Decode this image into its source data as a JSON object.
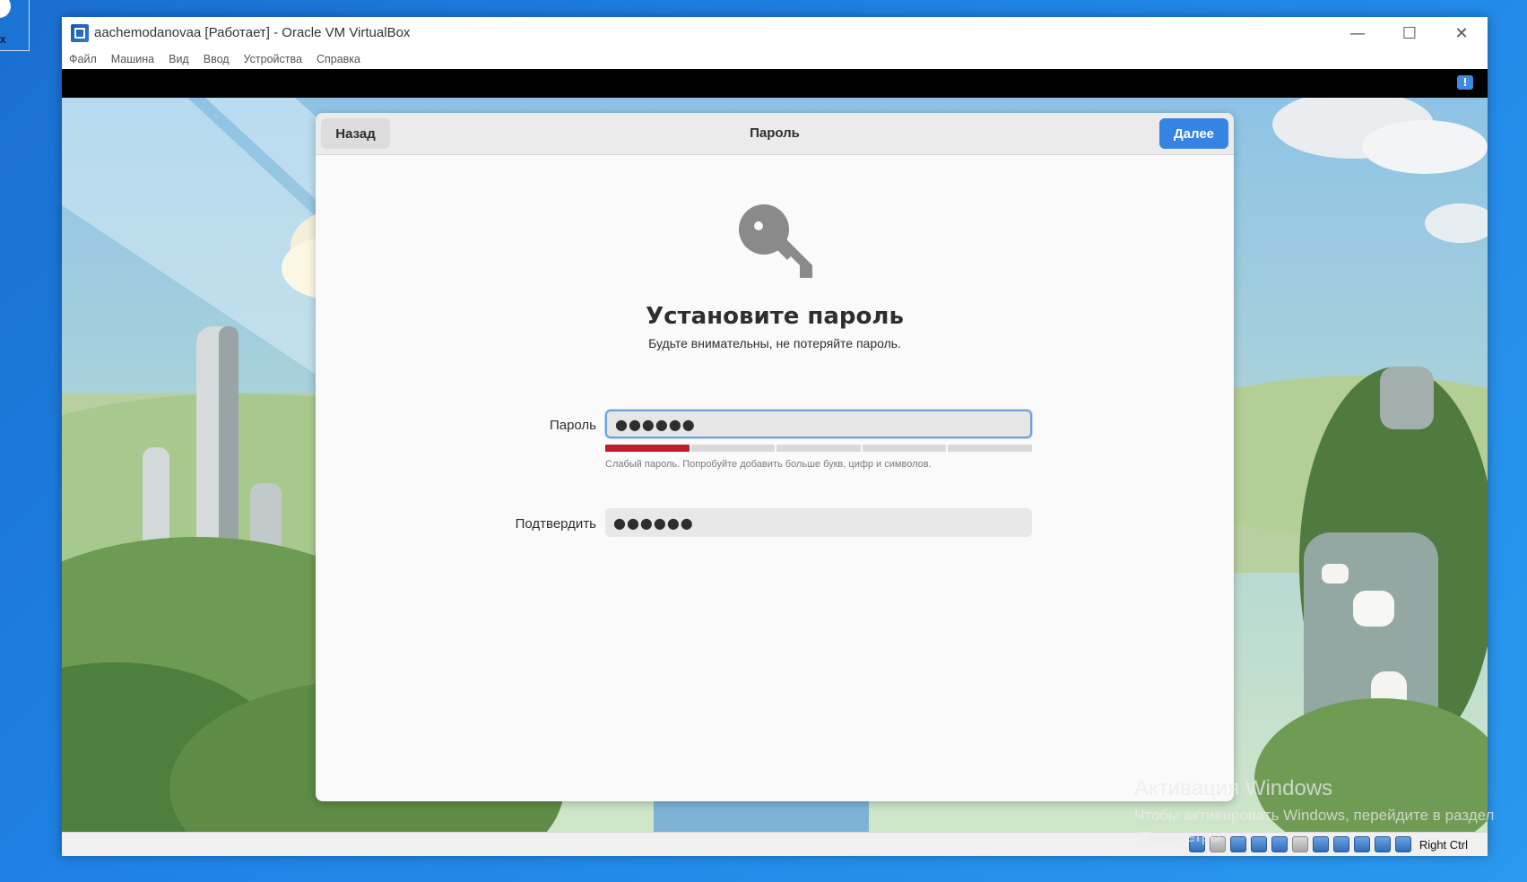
{
  "desktop": {
    "corner_text": "x"
  },
  "window": {
    "title": "aachemodanovaa [Работает] - Oracle VM VirtualBox",
    "controls": {
      "minimize": "—",
      "maximize": "☐",
      "close": "✕"
    },
    "menu": [
      "Файл",
      "Машина",
      "Вид",
      "Ввод",
      "Устройства",
      "Справка"
    ],
    "statusbar": {
      "host_key": "Right Ctrl"
    }
  },
  "dialog": {
    "back_label": "Назад",
    "title": "Пароль",
    "next_label": "Далее",
    "heading": "Установите пароль",
    "subtitle": "Будьте внимательны, не потеряйте пароль.",
    "password": {
      "label": "Пароль",
      "value": "●●●●●●",
      "strength_segments": 5,
      "strength_filled": 1,
      "hint": "Слабый пароль. Попробуйте добавить больше букв, цифр и символов."
    },
    "confirm": {
      "label": "Подтвердить",
      "value": "●●●●●●"
    }
  },
  "watermark": {
    "title": "Активация Windows",
    "line1": "Чтобы активировать Windows, перейдите в раздел",
    "line2": "\"Параметры\"."
  },
  "colors": {
    "accent": "#3584e4",
    "weak": "#c01c28",
    "desktop": "#1f84e6"
  }
}
